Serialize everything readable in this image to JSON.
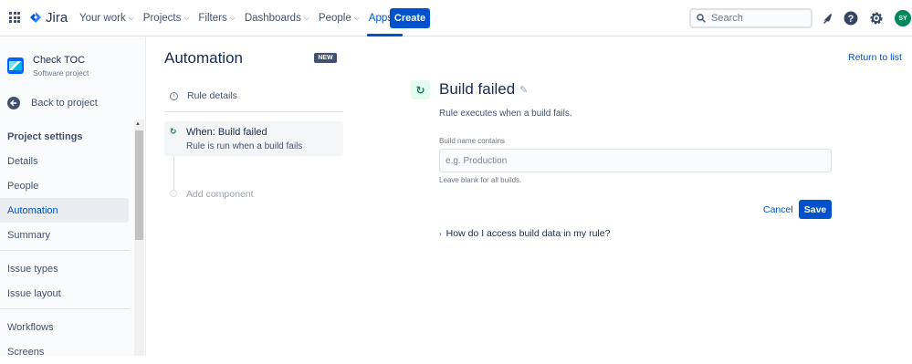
{
  "topnav": {
    "app_name": "Jira",
    "items": [
      {
        "label": "Your work"
      },
      {
        "label": "Projects"
      },
      {
        "label": "Filters"
      },
      {
        "label": "Dashboards"
      },
      {
        "label": "People"
      },
      {
        "label": "Apps"
      }
    ],
    "active_item": "Apps",
    "create_label": "Create",
    "search_placeholder": "Search",
    "avatar_initials": "SY",
    "brand_color": "#0052cc",
    "avatar_color": "#00875a"
  },
  "sidebar": {
    "project_name": "Check TOC",
    "project_type": "Software project",
    "back_label": "Back to project",
    "heading": "Project settings",
    "items": [
      {
        "label": "Details"
      },
      {
        "label": "People"
      },
      {
        "label": "Automation"
      },
      {
        "label": "Summary"
      },
      {
        "label": "Issue types"
      },
      {
        "label": "Issue layout"
      },
      {
        "label": "Workflows"
      },
      {
        "label": "Screens"
      }
    ],
    "active_item": "Automation"
  },
  "automation": {
    "title": "Automation",
    "badge": "NEW",
    "rule_details_label": "Rule details",
    "trigger_title": "When: Build failed",
    "trigger_subtitle": "Rule is run when a build fails",
    "add_component_label": "Add component",
    "return_label": "Return to list"
  },
  "trigger_panel": {
    "title": "Build failed",
    "description": "Rule executes when a build fails.",
    "field_label": "Build name contains",
    "field_value": "",
    "field_placeholder": "e.g. Production",
    "field_help": "Leave blank for all builds.",
    "cancel_label": "Cancel",
    "save_label": "Save",
    "faq_label": "How do I access build data in my rule?"
  }
}
